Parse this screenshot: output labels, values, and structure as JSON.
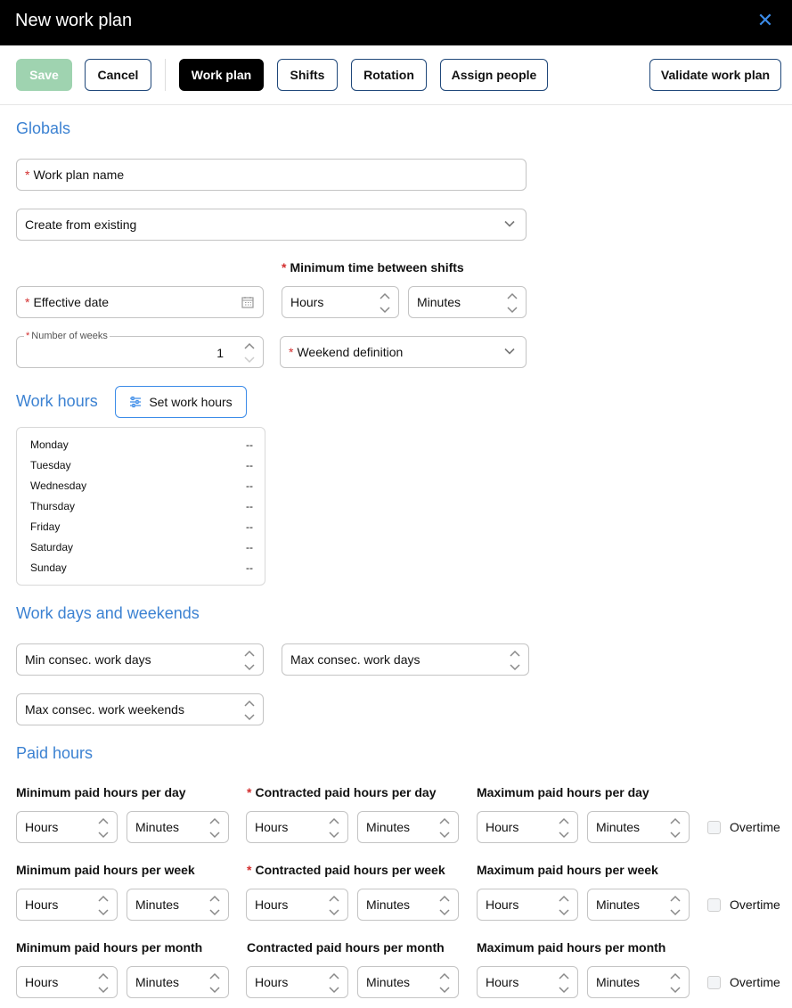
{
  "window": {
    "title": "New work plan"
  },
  "toolbar": {
    "save": "Save",
    "cancel": "Cancel",
    "work_plan": "Work plan",
    "shifts": "Shifts",
    "rotation": "Rotation",
    "assign_people": "Assign people",
    "validate": "Validate work plan"
  },
  "globals": {
    "title": "Globals",
    "work_plan_name": "Work plan name",
    "create_from_existing": "Create from existing",
    "min_time_between_shifts": "Minimum time between shifts",
    "effective_date": "Effective date",
    "hours": "Hours",
    "minutes": "Minutes",
    "number_of_weeks_label": "Number of weeks",
    "number_of_weeks_value": "1",
    "weekend_definition": "Weekend definition"
  },
  "work_hours": {
    "title": "Work hours",
    "set_button": "Set work hours",
    "days": [
      {
        "day": "Monday",
        "value": "--"
      },
      {
        "day": "Tuesday",
        "value": "--"
      },
      {
        "day": "Wednesday",
        "value": "--"
      },
      {
        "day": "Thursday",
        "value": "--"
      },
      {
        "day": "Friday",
        "value": "--"
      },
      {
        "day": "Saturday",
        "value": "--"
      },
      {
        "day": "Sunday",
        "value": "--"
      }
    ]
  },
  "work_days": {
    "title": "Work days and weekends",
    "min_consec_days": "Min consec. work days",
    "max_consec_days": "Max consec. work days",
    "max_consec_weekends": "Max consec. work weekends"
  },
  "paid_hours": {
    "title": "Paid hours",
    "hours": "Hours",
    "minutes": "Minutes",
    "overtime": "Overtime",
    "rows": [
      {
        "min": "Minimum paid hours per day",
        "contracted": "Contracted paid hours per day",
        "max": "Maximum paid hours per day"
      },
      {
        "min": "Minimum paid hours per week",
        "contracted": "Contracted paid hours per week",
        "max": "Maximum paid hours per week"
      },
      {
        "min": "Minimum paid hours per month",
        "contracted": "Contracted paid hours per month",
        "max": "Maximum paid hours per month"
      }
    ]
  },
  "colors": {
    "accent": "#3c82d2",
    "save_disabled": "#9fd3b0",
    "required": "#d32f2f",
    "titlebar": "#000000"
  },
  "icons": [
    "close-icon",
    "chevron-down-icon",
    "spinner-icon",
    "calendar-icon",
    "sliders-icon"
  ]
}
